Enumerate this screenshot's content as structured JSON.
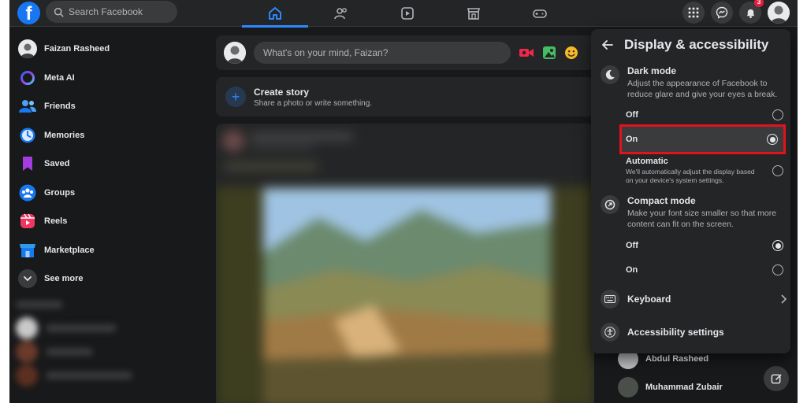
{
  "header": {
    "logo": "f",
    "search_placeholder": "Search Facebook",
    "nav_tabs": [
      "home-icon",
      "friends-icon",
      "watch-icon",
      "marketplace-icon",
      "gaming-icon"
    ],
    "notification_count": "3"
  },
  "sidebar": {
    "user_name": "Faizan Rasheed",
    "items": [
      {
        "label": "Meta AI",
        "icon": "meta-ai-icon"
      },
      {
        "label": "Friends",
        "icon": "friends-icon"
      },
      {
        "label": "Memories",
        "icon": "memories-icon"
      },
      {
        "label": "Saved",
        "icon": "saved-icon"
      },
      {
        "label": "Groups",
        "icon": "groups-icon"
      },
      {
        "label": "Reels",
        "icon": "reels-icon"
      },
      {
        "label": "Marketplace",
        "icon": "marketplace-icon"
      },
      {
        "label": "See more",
        "icon": "chevron-down-icon"
      }
    ]
  },
  "composer": {
    "placeholder": "What's on your mind, Faizan?"
  },
  "story": {
    "title": "Create story",
    "subtitle": "Share a photo or write something."
  },
  "panel": {
    "title": "Display & accessibility",
    "dark_mode": {
      "title": "Dark mode",
      "description": "Adjust the appearance of Facebook to reduce glare and give your eyes a break.",
      "off_label": "Off",
      "on_label": "On",
      "automatic_label": "Automatic",
      "automatic_description": "We'll automatically adjust the display based on your device's system settings.",
      "selected": "On"
    },
    "compact_mode": {
      "title": "Compact mode",
      "description": "Make your font size smaller so that more content can fit on the screen.",
      "off_label": "Off",
      "on_label": "On",
      "selected": "Off"
    },
    "keyboard_label": "Keyboard",
    "accessibility_label": "Accessibility settings"
  },
  "contacts": [
    {
      "name": "Abdul Rasheed"
    },
    {
      "name": "Muhammad Zubair"
    }
  ],
  "colors": {
    "background": "#18191a",
    "surface": "#242526",
    "accent": "#2d88ff",
    "highlight_border": "#e3121b"
  }
}
